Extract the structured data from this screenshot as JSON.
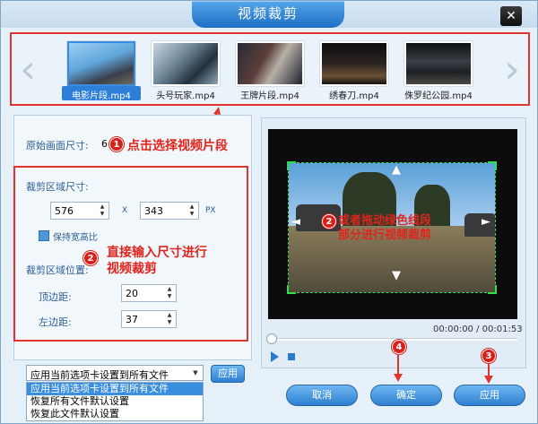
{
  "window": {
    "title": "视频裁剪",
    "close_glyph": "✕"
  },
  "clips": {
    "prev_glyph": "‹",
    "next_glyph": "›",
    "items": [
      {
        "label": "电影片段.mp4",
        "selected": true
      },
      {
        "label": "头号玩家.mp4",
        "selected": false
      },
      {
        "label": "王牌片段.mp4",
        "selected": false
      },
      {
        "label": "绣春刀.mp4",
        "selected": false
      },
      {
        "label": "侏罗纪公园.mp4",
        "selected": false
      }
    ]
  },
  "annotations": {
    "select_clip": "点击选择视频片段",
    "input_size_line1": "直接输入尺寸进行",
    "input_size_line2": "视频裁剪",
    "drag_line1": "或者拖动绿色线段",
    "drag_line2": "部分进行视频裁剪",
    "badges": [
      "1",
      "2",
      "2",
      "3",
      "4"
    ]
  },
  "settings": {
    "original_size_label": "原始画面尺寸:",
    "original_size_value": "6",
    "crop_size_label": "裁剪区域尺寸:",
    "width_value": "576",
    "times_glyph": "X",
    "height_value": "343",
    "unit": "PX",
    "keep_ratio_label": "保持宽高比",
    "crop_position_label": "裁剪区域位置:",
    "top_margin_label": "顶边距:",
    "top_margin_value": "20",
    "left_margin_label": "左边距:",
    "left_margin_value": "37"
  },
  "apply_scope": {
    "selected": "应用当前选项卡设置到所有文件",
    "apply_label": "应用",
    "options": [
      "应用当前选项卡设置到所有文件",
      "恢复所有文件默认设置",
      "恢复此文件默认设置"
    ]
  },
  "preview": {
    "time": "00:00:00 / 00:01:53",
    "progress": 0
  },
  "buttons": {
    "cancel": "取消",
    "ok": "确定",
    "apply": "应用"
  },
  "colors": {
    "accent": "#2e7fd0",
    "annotation_red": "#e0342c",
    "crop_green": "#2ee04e"
  }
}
